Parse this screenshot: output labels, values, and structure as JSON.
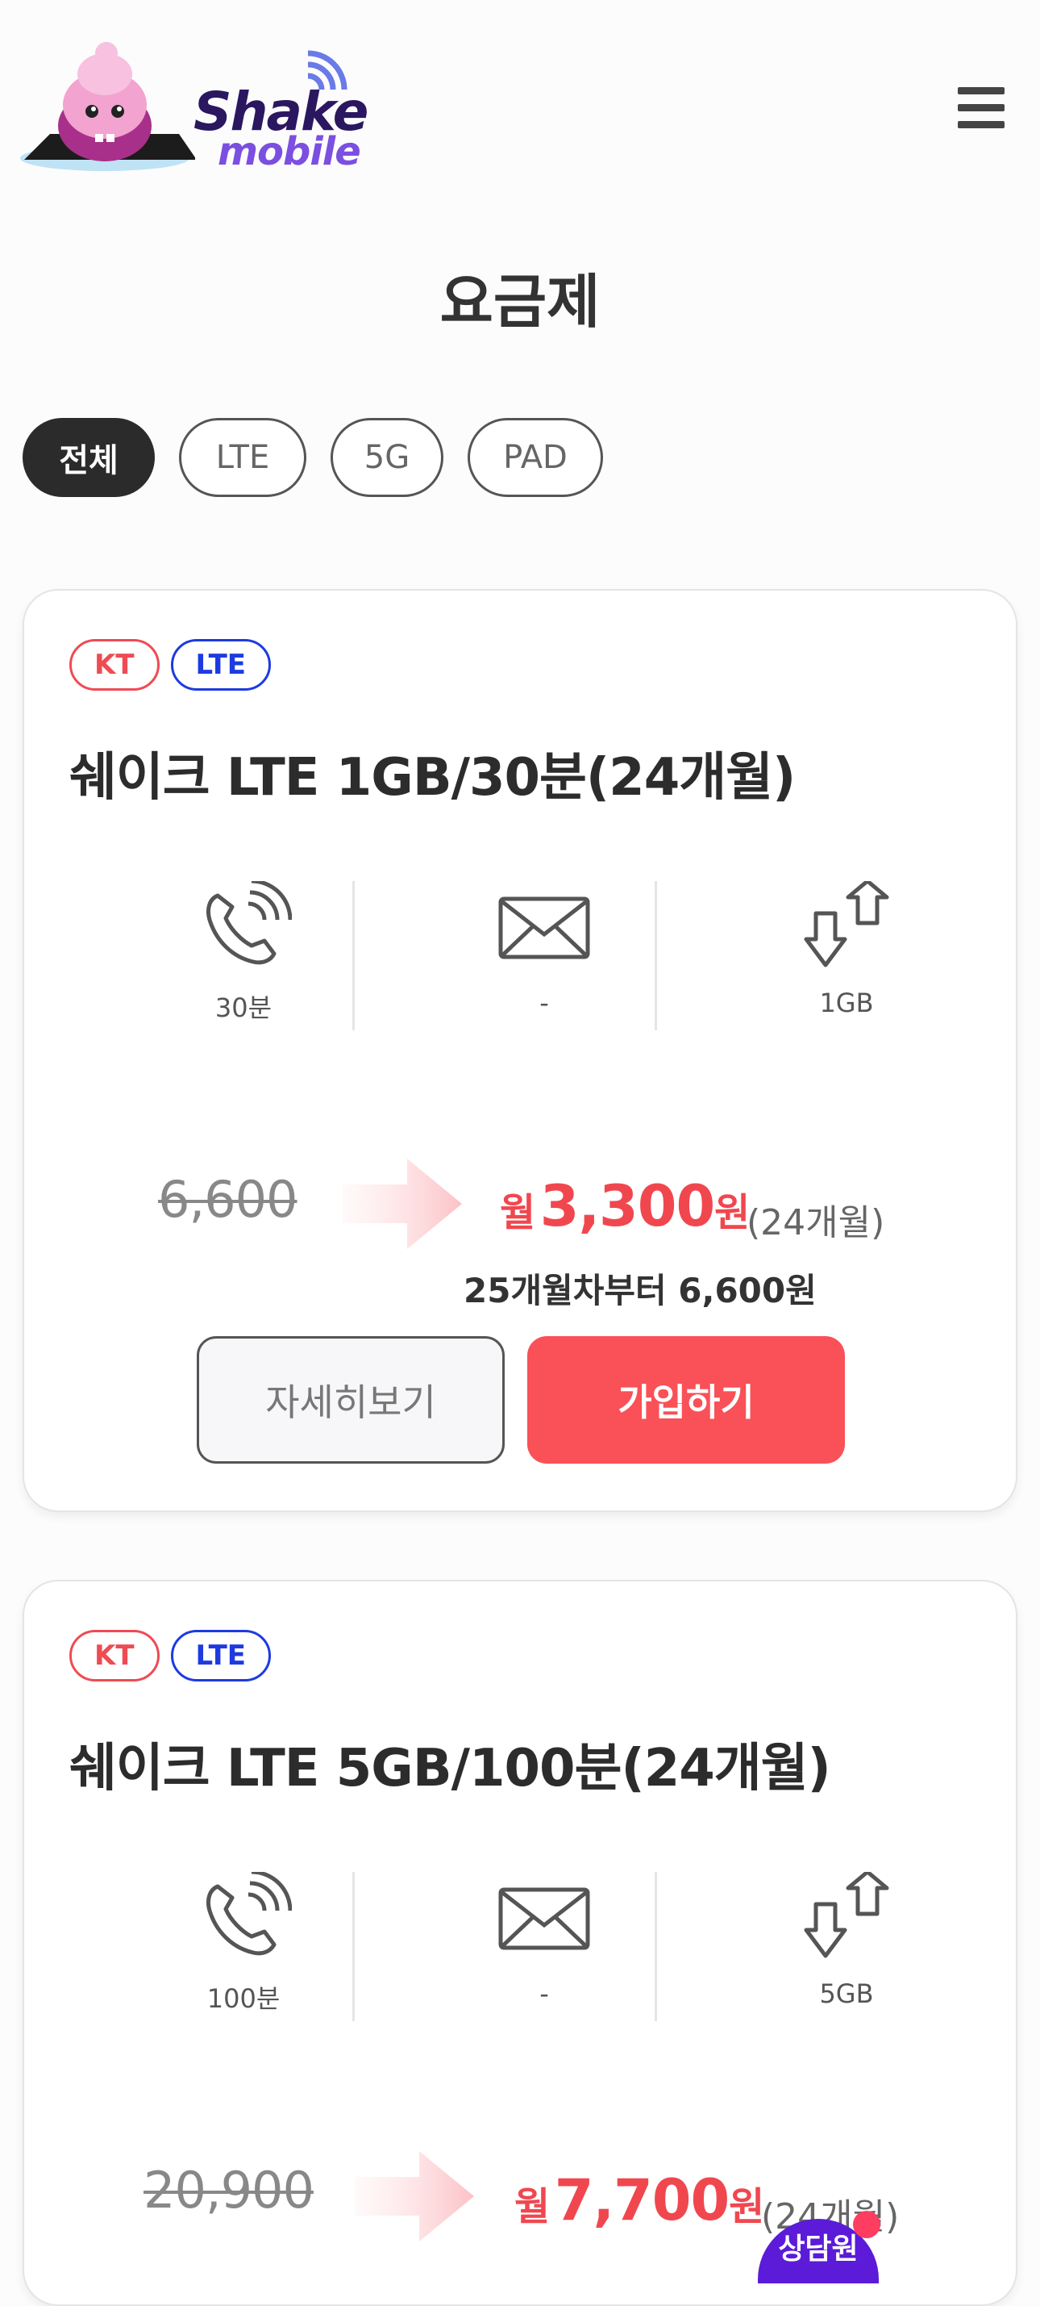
{
  "brand": {
    "name_line1": "Shake",
    "name_line2": "mobile"
  },
  "page": {
    "title": "요금제"
  },
  "filters": [
    {
      "label": "전체",
      "active": true
    },
    {
      "label": "LTE",
      "active": false
    },
    {
      "label": "5G",
      "active": false
    },
    {
      "label": "PAD",
      "active": false
    }
  ],
  "plans": [
    {
      "carrier": "KT",
      "network": "LTE",
      "name": "쉐이크 LTE 1GB/30분(24개월)",
      "voice": "30분",
      "sms": "-",
      "data": "1GB",
      "original_price": "6,600",
      "month_prefix": "월",
      "sale_price": "3,300",
      "currency": "원",
      "period": "(24개월)",
      "after_note": "25개월차부터 6,600원",
      "detail_label": "자세히보기",
      "join_label": "가입하기"
    },
    {
      "carrier": "KT",
      "network": "LTE",
      "name": "쉐이크 LTE 5GB/100분(24개월)",
      "voice": "100분",
      "sms": "-",
      "data": "5GB",
      "original_price": "20,900",
      "month_prefix": "월",
      "sale_price": "7,700",
      "currency": "원",
      "period": "(24개월)"
    }
  ],
  "chat": {
    "label": "상담원"
  },
  "colors": {
    "accent": "#fa5057",
    "kt": "#ef4b53",
    "lte": "#1d3be0",
    "chat": "#5b1bd8"
  },
  "icons": [
    "phone-icon",
    "envelope-icon",
    "data-transfer-icon",
    "menu-icon",
    "mascot-logo-icon"
  ]
}
